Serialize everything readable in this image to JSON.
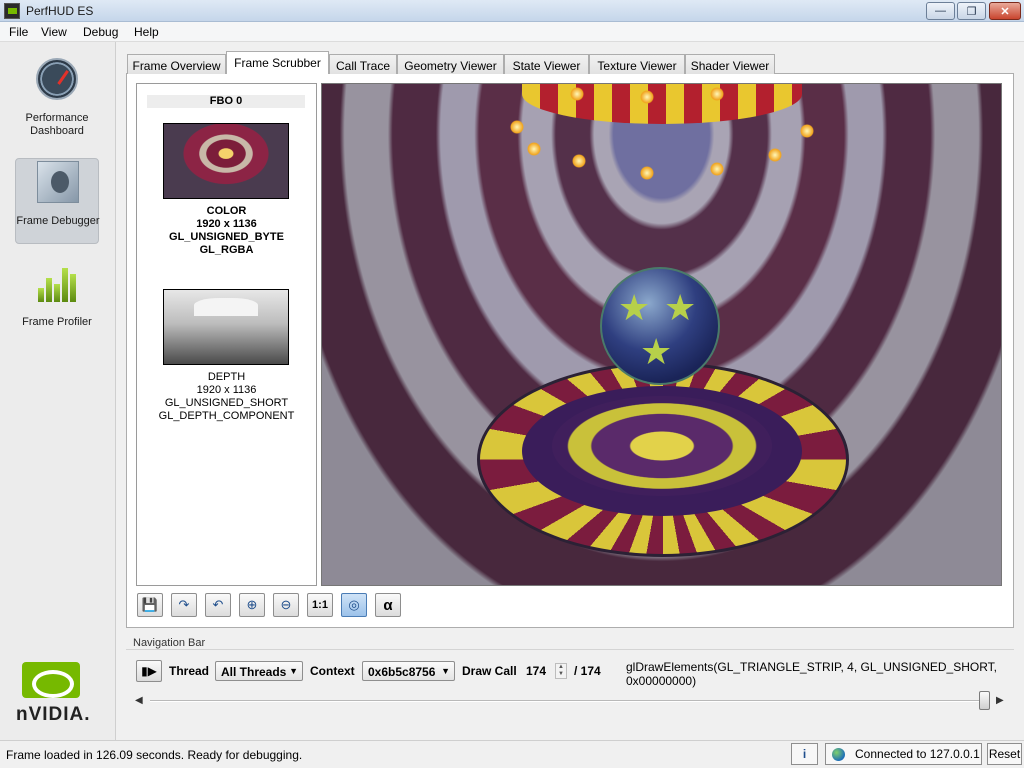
{
  "window": {
    "title": "PerfHUD ES",
    "minimize": "—",
    "maximize": "❐",
    "close": "✕"
  },
  "menu": [
    "File",
    "View",
    "Debug",
    "Help"
  ],
  "sidebar": {
    "items": [
      {
        "label": "Performance Dashboard",
        "icon": "gauge-icon"
      },
      {
        "label": "Frame Debugger",
        "icon": "bug-icon",
        "active": true
      },
      {
        "label": "Frame Profiler",
        "icon": "bar-chart-icon"
      }
    ],
    "logo_text": "nVIDIA."
  },
  "tabs": [
    {
      "label": "Frame Overview"
    },
    {
      "label": "Frame Scrubber",
      "active": true
    },
    {
      "label": "Call Trace"
    },
    {
      "label": "Geometry Viewer"
    },
    {
      "label": "State Viewer"
    },
    {
      "label": "Texture Viewer"
    },
    {
      "label": "Shader Viewer"
    }
  ],
  "fbo": {
    "header": "FBO 0",
    "color": {
      "name": "COLOR",
      "size": "1920 x 1136",
      "type": "GL_UNSIGNED_BYTE",
      "format": "GL_RGBA"
    },
    "depth": {
      "name": "DEPTH",
      "size": "1920 x 1136",
      "type": "GL_UNSIGNED_SHORT",
      "format": "GL_DEPTH_COMPONENT"
    }
  },
  "toolbar": {
    "buttons": [
      {
        "icon": "save-icon",
        "glyph": "💾"
      },
      {
        "icon": "redo-icon",
        "glyph": "↷"
      },
      {
        "icon": "undo-icon",
        "glyph": "↶"
      },
      {
        "icon": "zoom-in-icon",
        "glyph": "⊕"
      },
      {
        "icon": "zoom-out-icon",
        "glyph": "⊖"
      },
      {
        "icon": "actual-size-icon",
        "glyph": "1:1"
      },
      {
        "icon": "wireframe-icon",
        "glyph": "◎",
        "active": true
      },
      {
        "icon": "alpha-icon",
        "glyph": "α"
      }
    ]
  },
  "navigation": {
    "group_label": "Navigation Bar",
    "icon": "film-icon",
    "thread_label": "Thread",
    "thread_value": "All Threads",
    "context_label": "Context",
    "context_value": "0x6b5c8756",
    "draw_call_label": "Draw Call",
    "draw_call_value": "174",
    "draw_call_total": "/ 174",
    "call_text": "glDrawElements(GL_TRIANGLE_STRIP, 4, GL_UNSIGNED_SHORT, 0x00000000)",
    "slider_position": 1.0
  },
  "status": {
    "message": "Frame loaded in 126.09 seconds.  Ready for debugging.",
    "info_glyph": "i",
    "connection": "Connected to 127.0.0.1",
    "reset": "Reset"
  }
}
